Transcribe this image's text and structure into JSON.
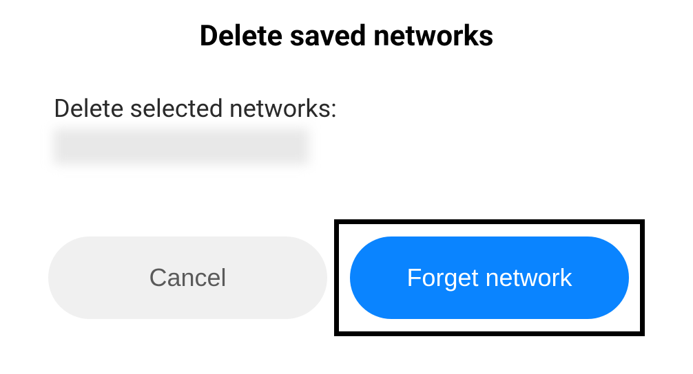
{
  "dialog": {
    "title": "Delete saved networks",
    "message": "Delete selected networks:",
    "network_name_redacted": true,
    "buttons": {
      "cancel": "Cancel",
      "confirm": "Forget network"
    }
  },
  "colors": {
    "primary": "#0a84ff",
    "cancel_bg": "#f0f0f0",
    "cancel_text": "#5a5a5a",
    "highlight_border": "#000000"
  }
}
